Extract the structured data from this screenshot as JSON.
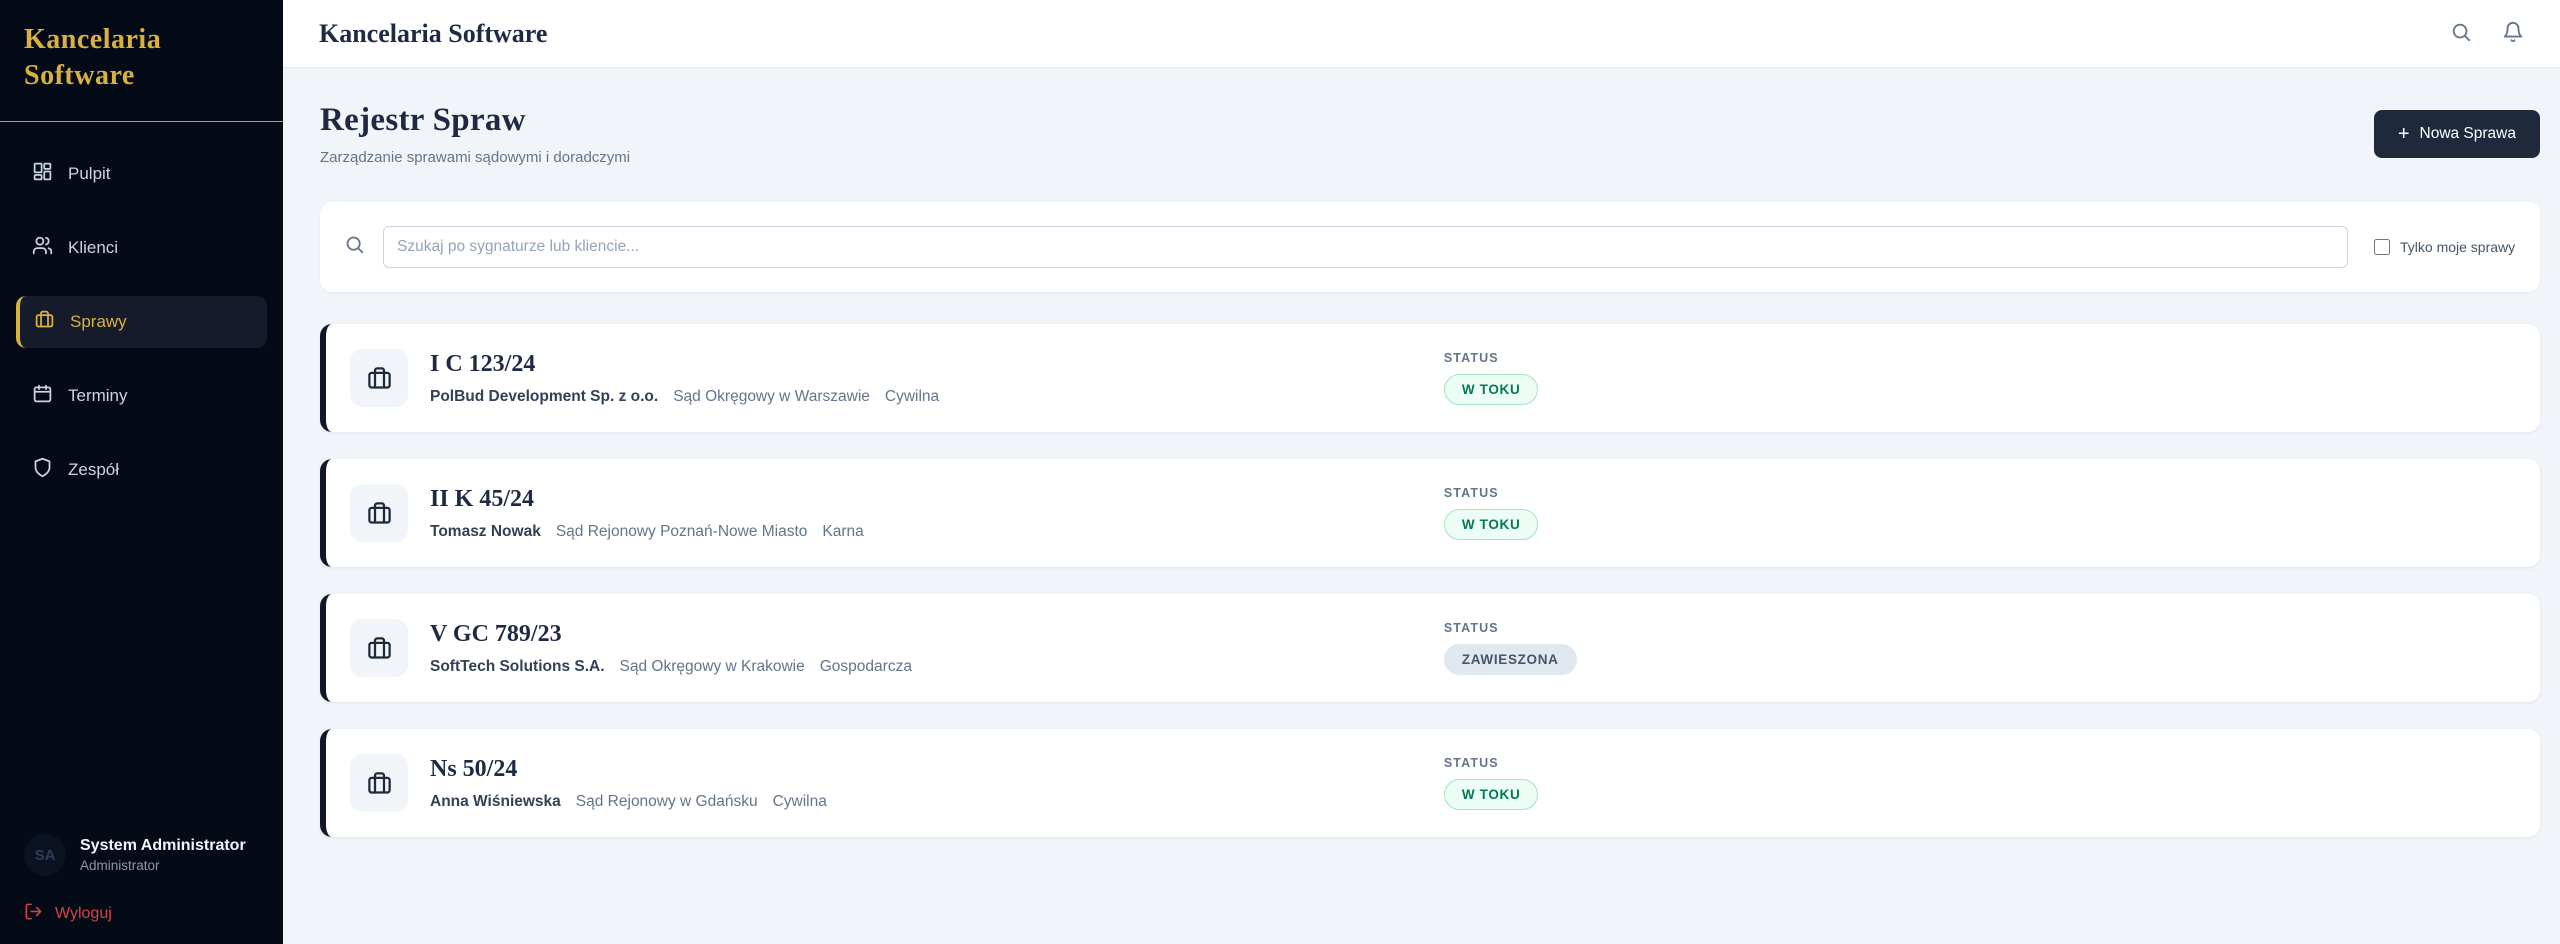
{
  "brand": {
    "logo_line1": "Kancelaria",
    "logo_line2": "Software",
    "header_title": "Kancelaria Software"
  },
  "sidebar": {
    "items": [
      {
        "label": "Pulpit"
      },
      {
        "label": "Klienci"
      },
      {
        "label": "Sprawy",
        "active": true
      },
      {
        "label": "Terminy"
      },
      {
        "label": "Zespół"
      }
    ],
    "user": {
      "initials": "SA",
      "name": "System Administrator",
      "role": "Administrator"
    },
    "logout_label": "Wyloguj"
  },
  "page": {
    "title": "Rejestr Spraw",
    "subtitle": "Zarządzanie sprawami sądowymi i doradczymi",
    "new_case_label": "Nowa Sprawa",
    "plus_glyph": "+"
  },
  "filters": {
    "search_placeholder": "Szukaj po sygnaturze lub kliencie...",
    "search_value": "",
    "only_mine_label": "Tylko moje sprawy",
    "only_mine_checked": false
  },
  "cases": {
    "status_label": "STATUS",
    "items": [
      {
        "signature": "I C 123/24",
        "client": "PolBud Development Sp. z o.o.",
        "court": "Sąd Okręgowy w Warszawie",
        "type": "Cywilna",
        "status": "W TOKU",
        "status_kind": "active"
      },
      {
        "signature": "II K 45/24",
        "client": "Tomasz Nowak",
        "court": "Sąd Rejonowy Poznań-Nowe Miasto",
        "type": "Karna",
        "status": "W TOKU",
        "status_kind": "active"
      },
      {
        "signature": "V GC 789/23",
        "client": "SoftTech Solutions S.A.",
        "court": "Sąd Okręgowy w Krakowie",
        "type": "Gospodarcza",
        "status": "ZAWIESZONA",
        "status_kind": "suspended"
      },
      {
        "signature": "Ns 50/24",
        "client": "Anna Wiśniewska",
        "court": "Sąd Rejonowy w Gdańsku",
        "type": "Cywilna",
        "status": "W TOKU",
        "status_kind": "active"
      }
    ]
  },
  "colors": {
    "sidebar_bg": "#050a17",
    "gold_accent": "#d9b13f",
    "dark_navy": "#1e293b",
    "main_bg": "#f1f5f9",
    "status_active_text": "#047857",
    "status_suspended_text": "#475569",
    "logout_red": "#d84444"
  }
}
